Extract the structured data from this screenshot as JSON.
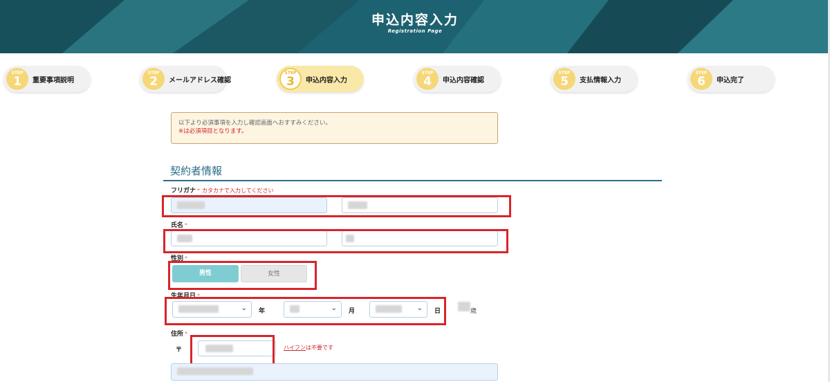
{
  "header": {
    "title": "申込内容入力",
    "subtitle": "Registration Page"
  },
  "steps": [
    {
      "badge": "STEP",
      "number": "1",
      "label": "重要事項説明"
    },
    {
      "badge": "STEP",
      "number": "2",
      "label": "メールアドレス確認"
    },
    {
      "badge": "STEP",
      "number": "3",
      "label": "申込内容入力"
    },
    {
      "badge": "STEP",
      "number": "4",
      "label": "申込内容確認"
    },
    {
      "badge": "STEP",
      "number": "5",
      "label": "支払情報入力"
    },
    {
      "badge": "STEP",
      "number": "6",
      "label": "申込完了"
    }
  ],
  "notice": {
    "line1": "以下より必須事項を入力し確認画面へおすすみください。",
    "line2": "※は必須項目となります。"
  },
  "section_title": "契約者情報",
  "fields": {
    "furigana": {
      "label": "フリガナ",
      "required": "*",
      "hint": "カタカナで入力してください"
    },
    "name": {
      "label": "氏名",
      "required": "*"
    },
    "gender": {
      "label": "性別",
      "required": "*",
      "male": "男性",
      "female": "女性"
    },
    "birthdate": {
      "label": "生年月日",
      "required": "*",
      "year_unit": "年",
      "month_unit": "月",
      "day_unit": "日",
      "age_suffix": "歳"
    },
    "address": {
      "label": "住所",
      "required": "*",
      "postal_mark": "〒",
      "hyphen_link": "ハイフン",
      "hyphen_note": "は不要です"
    }
  },
  "icons": {
    "select_chevron": "chevron-down-icon"
  },
  "colors": {
    "header_bg": "#1f5f6b",
    "accent": "#2a6d8a",
    "step_active": "#f9e8a8",
    "step_circle": "#f6d777",
    "highlight_box": "#d8242a",
    "male_btn": "#7fcdd2"
  }
}
